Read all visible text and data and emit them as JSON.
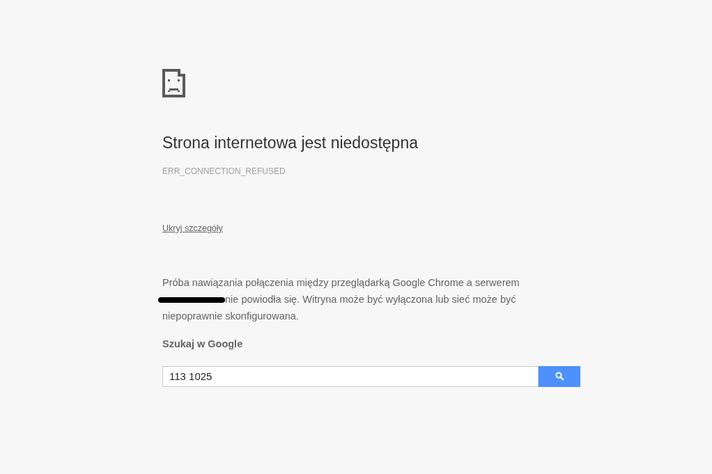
{
  "error_page": {
    "title": "Strona internetowa jest niedostępna",
    "error_code": "ERR_CONNECTION_REFUSED",
    "details_link": "Ukryj szczegóły",
    "details_before_redaction": "Próba nawiązania połączenia między przeglądarką Google Chrome a serwerem",
    "redacted": true,
    "details_after_redaction": "nie powiodła się. Witryna może być wyłączona lub sieć może być niepoprawnie skonfigurowana.",
    "search_heading": "Szukaj w Google",
    "search_value": "113 1025"
  }
}
